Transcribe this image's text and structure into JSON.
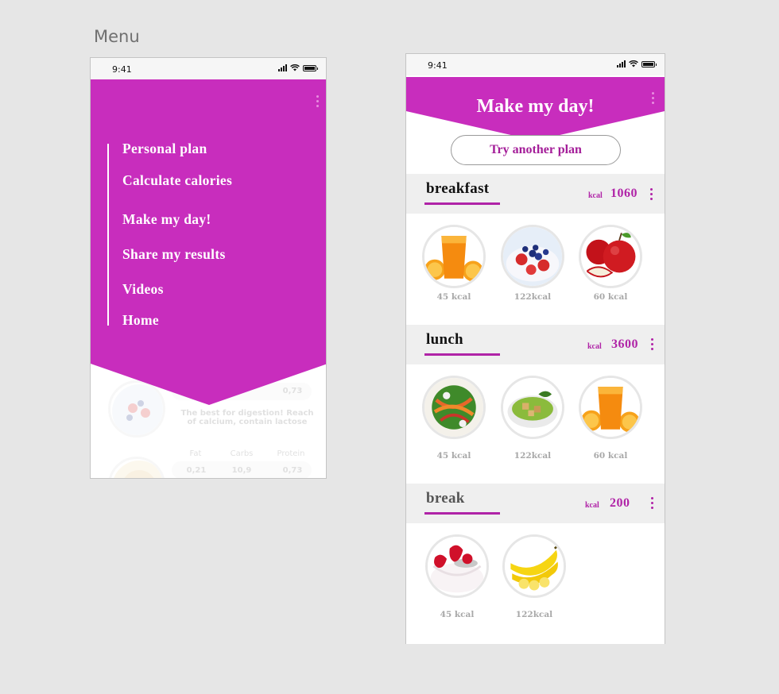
{
  "canvas": {
    "label": "Menu"
  },
  "menu_screen": {
    "status": {
      "time": "9:41"
    },
    "menu_items": [
      {
        "id": "personal-plan",
        "label": "Personal plan"
      },
      {
        "id": "calculate-calories",
        "label": "Calculate calories"
      },
      {
        "id": "make-my-day",
        "label": "Make my day!"
      },
      {
        "id": "share-my-results",
        "label": "Share my results"
      },
      {
        "id": "videos",
        "label": "Videos"
      },
      {
        "id": "home",
        "label": "Home"
      }
    ],
    "background_content": {
      "description": "The best for digestion! Reach of calcium, contain lactose",
      "macro_headers": [
        "Fat",
        "Carbs",
        "Protein"
      ],
      "macro_values_top": [
        "0,73"
      ],
      "macro_values_bottom": [
        "0,21",
        "10,9",
        "0,73"
      ]
    },
    "colors": {
      "accent": "#c82dbd"
    }
  },
  "plan_screen": {
    "status": {
      "time": "9:41"
    },
    "title": "Make my day!",
    "try_button": "Try another plan",
    "sections": [
      {
        "name": "breakfast",
        "kcal_unit": "kcal",
        "kcal_total": "1060",
        "items": [
          {
            "icon": "orange-juice-icon",
            "kcal": "45  kcal"
          },
          {
            "icon": "berry-yogurt-icon",
            "kcal": "122kcal"
          },
          {
            "icon": "apples-icon",
            "kcal": "60  kcal"
          }
        ]
      },
      {
        "name": "lunch",
        "kcal_unit": "kcal",
        "kcal_total": "3600",
        "items": [
          {
            "icon": "vegetable-salad-icon",
            "kcal": "45  kcal"
          },
          {
            "icon": "green-soup-icon",
            "kcal": "122kcal"
          },
          {
            "icon": "orange-juice-icon",
            "kcal": "60  kcal"
          }
        ]
      },
      {
        "name": "break",
        "kcal_unit": "kcal",
        "kcal_total": "200",
        "items": [
          {
            "icon": "strawberry-yogurt-icon",
            "kcal": "45  kcal"
          },
          {
            "icon": "bananas-icon",
            "kcal": "122kcal"
          }
        ]
      }
    ],
    "colors": {
      "accent": "#c82dbd",
      "text_accent": "#b023a7",
      "section_bg": "#efefef"
    }
  }
}
